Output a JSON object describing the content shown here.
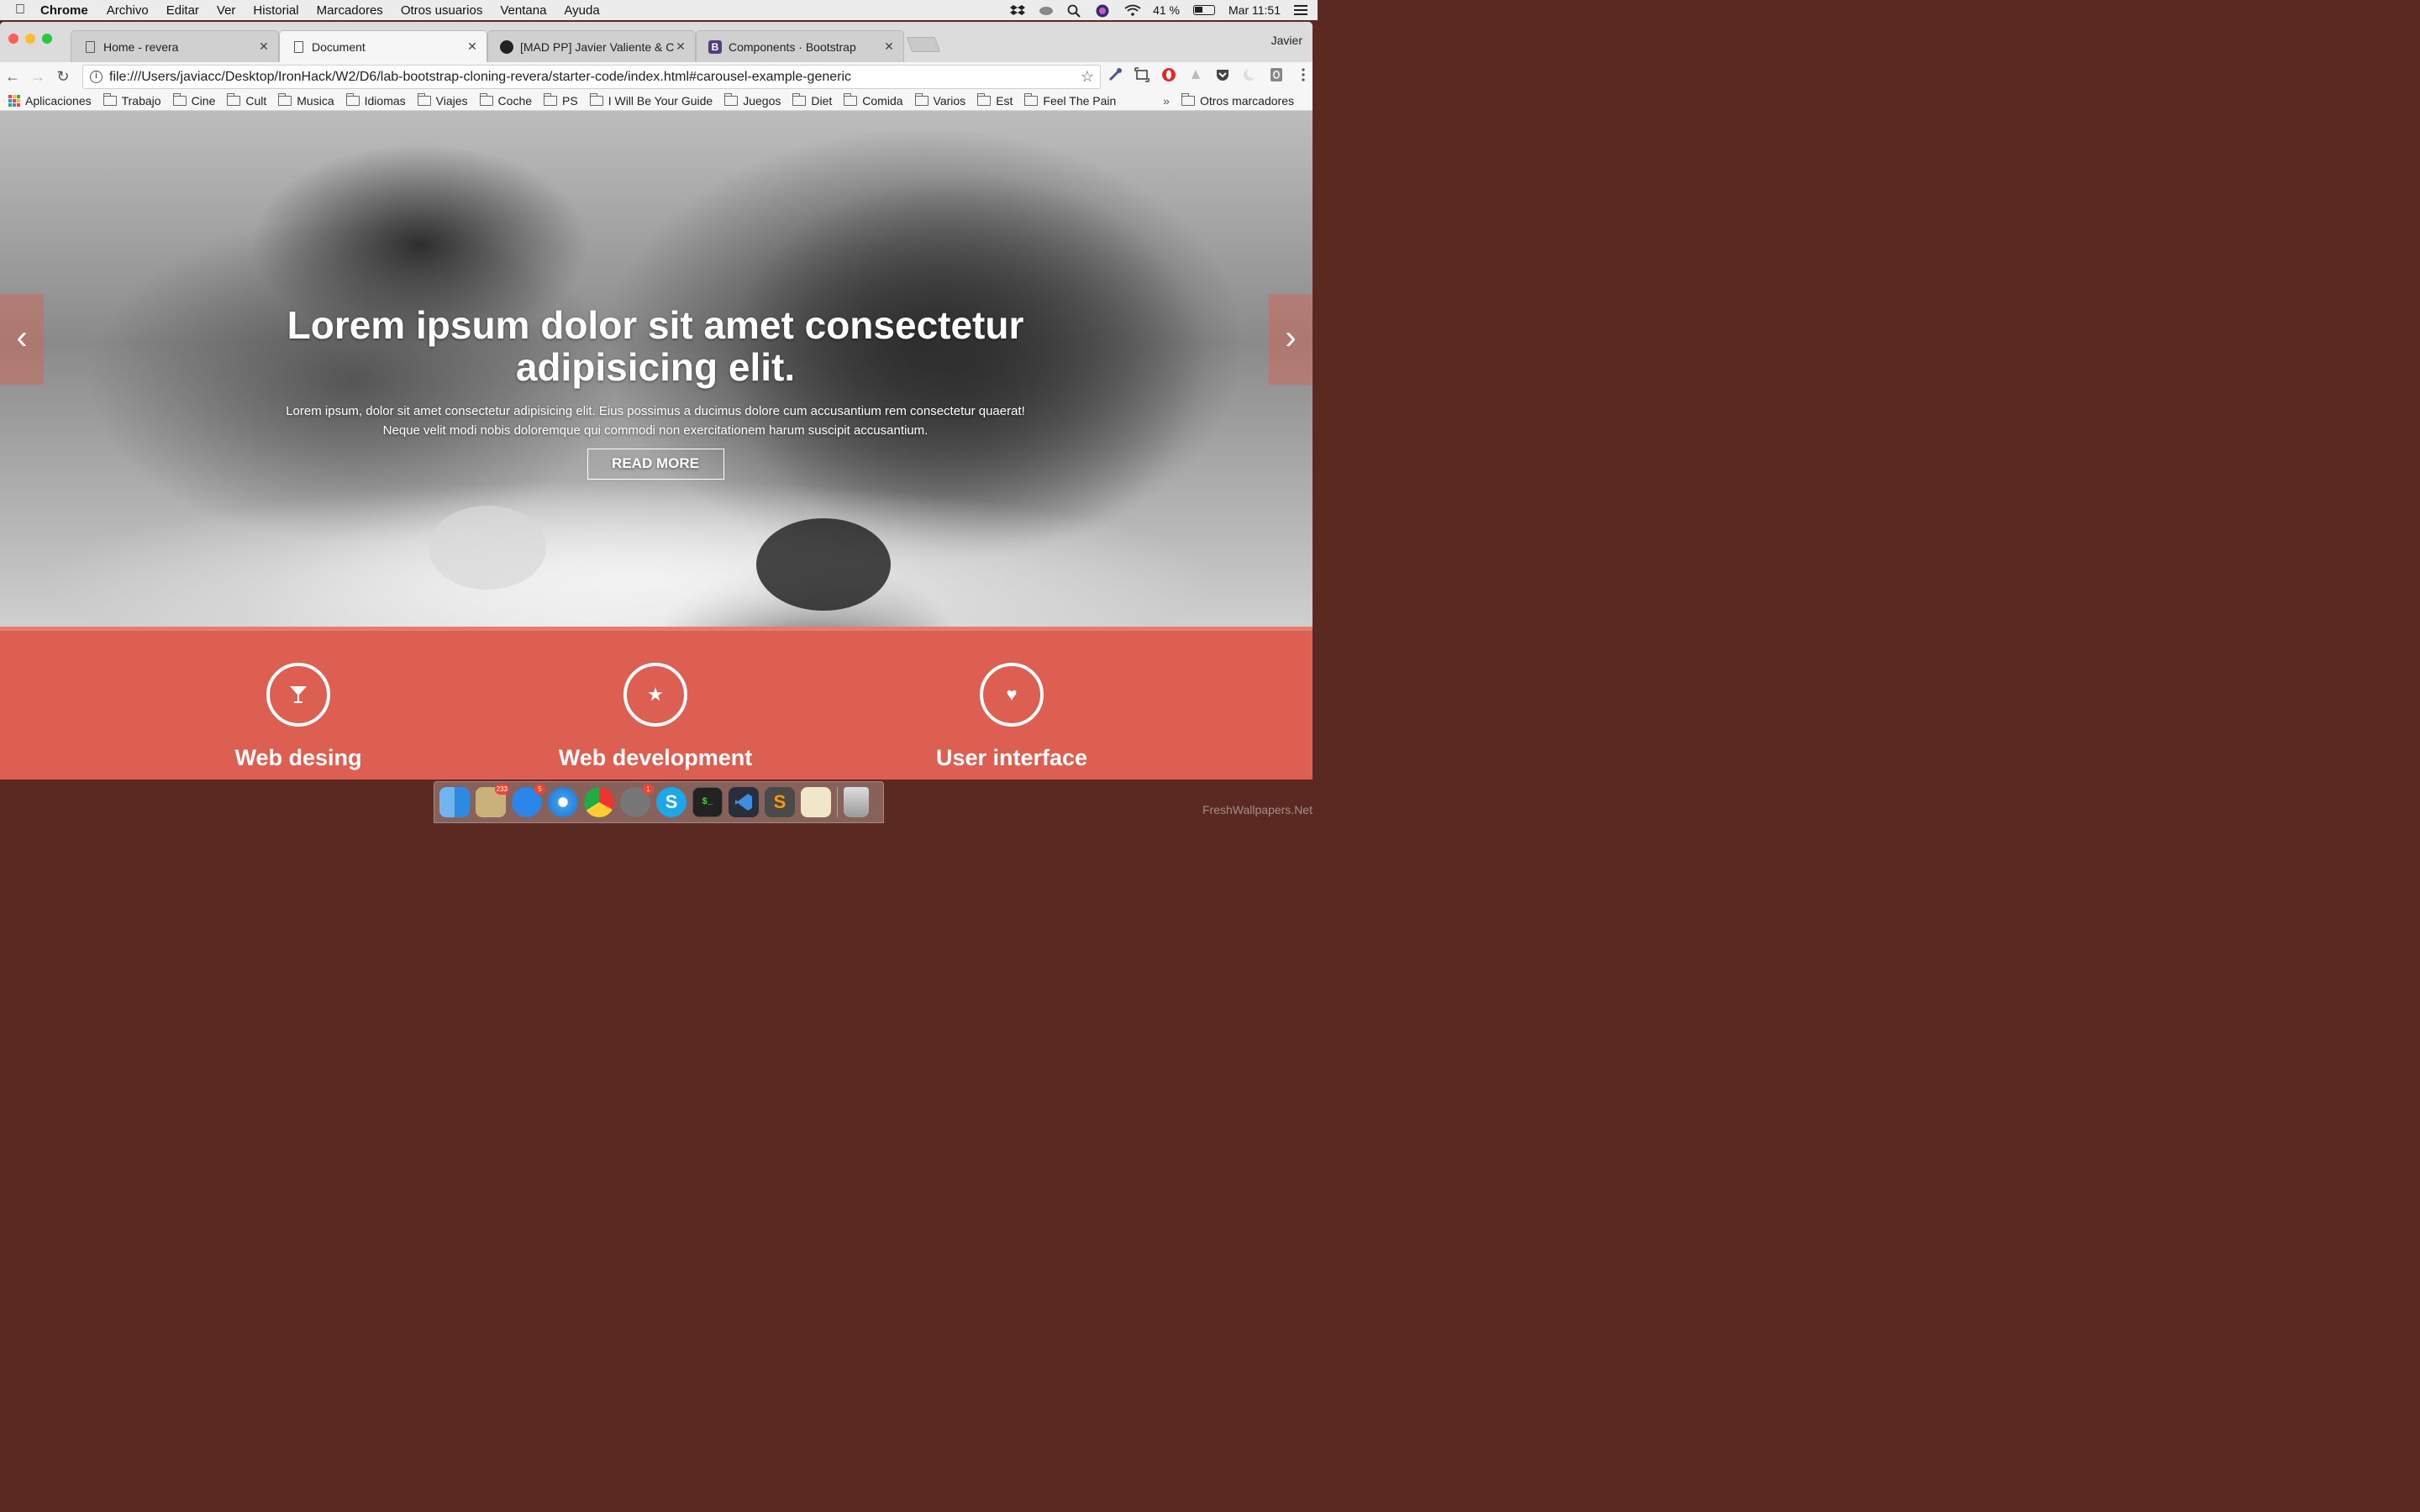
{
  "menubar": {
    "app_name": "Chrome",
    "items": [
      "Archivo",
      "Editar",
      "Ver",
      "Historial",
      "Marcadores",
      "Otros usuarios",
      "Ventana",
      "Ayuda"
    ],
    "battery": "41 %",
    "clock": "Mar 11:51"
  },
  "browser": {
    "profile": "Javier",
    "tabs": [
      {
        "title": "Home - revera",
        "icon": "document-icon"
      },
      {
        "title": "Document",
        "icon": "document-icon"
      },
      {
        "title": "[MAD PP] Javier Valiente & Ca",
        "icon": "github-icon"
      },
      {
        "title": "Components · Bootstrap",
        "icon": "bootstrap-icon",
        "icon_letter": "B"
      }
    ],
    "url": "file:///Users/javiacc/Desktop/IronHack/W2/D6/lab-bootstrap-cloning-revera/starter-code/index.html#carousel-example-generic",
    "bookmarks": [
      "Trabajo",
      "Cine",
      "Cult",
      "Musica",
      "Idiomas",
      "Viajes",
      "Coche",
      "PS",
      "I Will Be Your Guide",
      "Juegos",
      "Diet",
      "Comida",
      "Varios",
      "Est",
      "Feel The Pain"
    ],
    "apps_label": "Aplicaciones",
    "other_bookmarks": "Otros marcadores",
    "overflow": "»"
  },
  "page": {
    "hero": {
      "title": "Lorem ipsum dolor sit amet consectetur adipisicing elit.",
      "text_line1": "Lorem ipsum, dolor sit amet consectetur adipisicing elit. Eius possimus a ducimus dolore cum accusantium rem consectetur quaerat!",
      "text_line2": "Neque velit modi nobis doloremque qui commodi non exercitationem harum suscipit accusantium.",
      "button": "READ MORE",
      "prev": "‹",
      "next": "›"
    },
    "services": [
      {
        "title": "Web desing",
        "icon": "glass-icon",
        "glyph": "🍸"
      },
      {
        "title": "Web development",
        "icon": "star-icon",
        "glyph": "★"
      },
      {
        "title": "User interface",
        "icon": "heart-icon",
        "glyph": "♥"
      }
    ],
    "colors": {
      "accent": "#dc5f52"
    }
  },
  "dock": {
    "badges": {
      "mail": "233",
      "appstore": "5",
      "prefs": "1"
    },
    "terminal_label": "$_",
    "sublime_label": "S",
    "skype_label": "S"
  },
  "watermark": "FreshWallpapers.Net"
}
